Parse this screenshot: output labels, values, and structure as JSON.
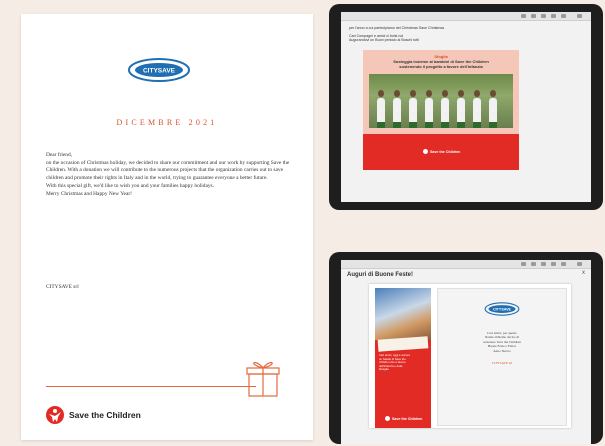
{
  "letter": {
    "date": "DICEMBRE 2021",
    "paragraphs": [
      "Dear friend,",
      "on the occasion of Christmas holiday, we decided to share our commitment and our work by supporting Save the Children. With a donation we will contribute to the numerous projects that the organization carries out to save children and promote their rights in Italy and in the world, trying to guarantee everyone a better future.",
      "With this special gift, we'd like to wish you and your families happy holidays.",
      "Merry Christmas and Happy New Year!"
    ],
    "signature": "CITYSAVE srl",
    "footer_logo_text": "Save the Children",
    "logo_text": "CITYSAVE",
    "accent_color": "#d9512b"
  },
  "tablet_top": {
    "intro_lines": [
      "per l'anno a cui partecipiamo del Christmas Save Christmas",
      "Cari Compagni e amici ci bolsi noi",
      "Augurandovi un Buon periodo ai Boschi tutti"
    ],
    "headline_line1": "Sfoglia",
    "headline_line2": "Sosteggia insieme ai bambini di Save the Children",
    "headline_line3": "sostenendo il progetto a favore dell'infanzia",
    "footer_logo_text": "Save the Children"
  },
  "tablet_bottom": {
    "title": "Auguri di Buone Feste!",
    "close": "x",
    "left_lines": [
      "Cari amici, oggi è ancora",
      "un Natale di Save the",
      "Children che a favore",
      "dell'infanzia e delle",
      "famiglie."
    ],
    "left_logo_text": "Save the Children",
    "right_lines": [
      "Cari amici, per questo",
      "Natale abbiamo deciso di",
      "sostenere Save the Children",
      "Buone Feste e Felice",
      "Anno Nuovo"
    ],
    "right_signature": "CITYSAVE srl",
    "logo_text": "CITYSAVE"
  }
}
